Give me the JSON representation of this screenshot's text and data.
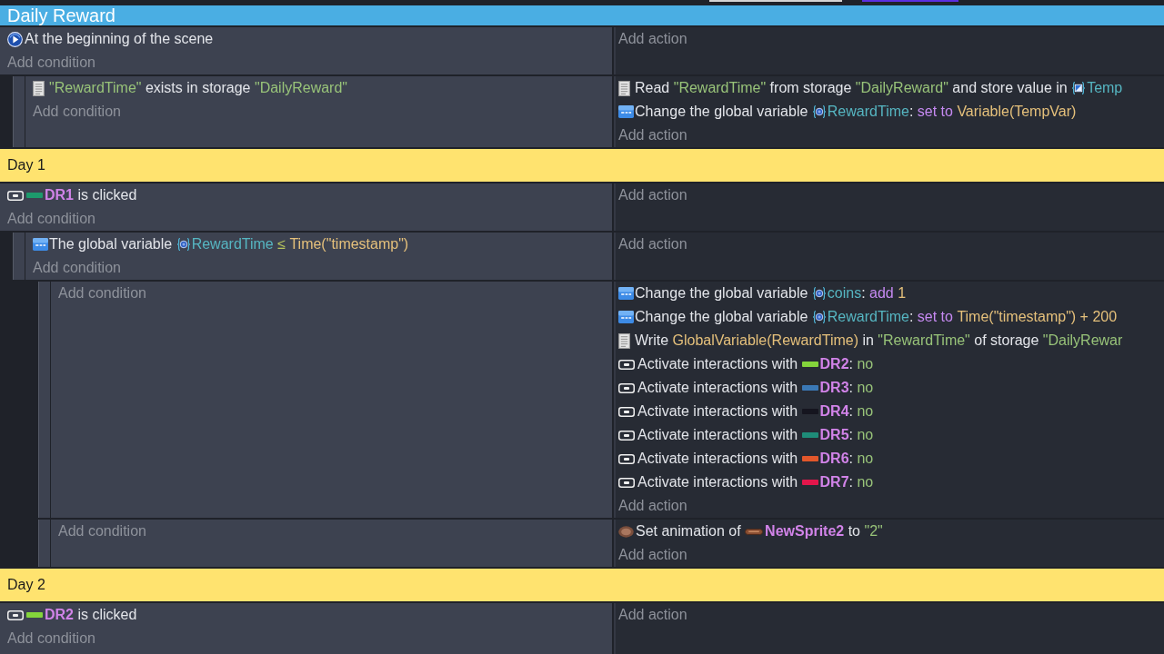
{
  "events": [
    {
      "kind": "group",
      "title": "Daily Reward"
    },
    {
      "kind": "event",
      "conditions": [
        {
          "kind": "scene_start",
          "parts": [
            {
              "kind": "plain",
              "text": "At the beginning of the scene"
            }
          ]
        }
      ],
      "add_condition": "Add condition",
      "add_action": "Add action",
      "children": [
        {
          "kind": "event",
          "conditions": [
            {
              "kind": "storage",
              "parts": [
                {
                  "kind": "string",
                  "text": "\"RewardTime\""
                },
                {
                  "kind": "plain",
                  "text": " exists in storage "
                },
                {
                  "kind": "string",
                  "text": "\"DailyReward\""
                }
              ]
            }
          ],
          "add_condition": "Add condition",
          "actions": [
            {
              "kind": "storage",
              "parts": [
                {
                  "kind": "plain",
                  "text": "Read "
                },
                {
                  "kind": "string",
                  "text": "\"RewardTime\""
                },
                {
                  "kind": "plain",
                  "text": " from storage "
                },
                {
                  "kind": "string",
                  "text": "\"DailyReward\""
                },
                {
                  "kind": "plain",
                  "text": " and store value in "
                },
                {
                  "kind": "scene_variable",
                  "text": "Temp"
                }
              ]
            },
            {
              "kind": "variable",
              "parts": [
                {
                  "kind": "plain",
                  "text": "Change the global variable "
                },
                {
                  "kind": "global_variable",
                  "text": "RewardTime"
                },
                {
                  "kind": "plain",
                  "text": ": "
                },
                {
                  "kind": "operator",
                  "text": "set to "
                },
                {
                  "kind": "expression",
                  "text": "Variable(TempVar)"
                }
              ]
            }
          ],
          "add_action": "Add action"
        }
      ]
    },
    {
      "kind": "comment",
      "text": "Day 1"
    },
    {
      "kind": "event",
      "conditions": [
        {
          "kind": "button",
          "parts": [
            {
              "kind": "object",
              "text": "DR1",
              "color": "#1d9a6c"
            },
            {
              "kind": "plain",
              "text": " is clicked"
            }
          ]
        }
      ],
      "add_condition": "Add condition",
      "add_action": "Add action",
      "children": [
        {
          "kind": "event",
          "conditions": [
            {
              "kind": "variable",
              "parts": [
                {
                  "kind": "plain",
                  "text": "The global variable "
                },
                {
                  "kind": "global_variable",
                  "text": "RewardTime"
                },
                {
                  "kind": "comparison",
                  "text": " ≤ "
                },
                {
                  "kind": "expression",
                  "text": "Time(\"timestamp\")"
                }
              ]
            }
          ],
          "add_condition": "Add condition",
          "add_action": "Add action",
          "children": [
            {
              "kind": "event",
              "add_condition": "Add condition",
              "actions": [
                {
                  "kind": "variable",
                  "parts": [
                    {
                      "kind": "plain",
                      "text": "Change the global variable "
                    },
                    {
                      "kind": "global_variable",
                      "text": "coins"
                    },
                    {
                      "kind": "plain",
                      "text": ": "
                    },
                    {
                      "kind": "operator",
                      "text": "add "
                    },
                    {
                      "kind": "expression",
                      "text": "1"
                    }
                  ]
                },
                {
                  "kind": "variable",
                  "parts": [
                    {
                      "kind": "plain",
                      "text": "Change the global variable "
                    },
                    {
                      "kind": "global_variable",
                      "text": "RewardTime"
                    },
                    {
                      "kind": "plain",
                      "text": ": "
                    },
                    {
                      "kind": "operator",
                      "text": "set to "
                    },
                    {
                      "kind": "expression",
                      "text": "Time(\"timestamp\") + 200"
                    }
                  ]
                },
                {
                  "kind": "storage",
                  "parts": [
                    {
                      "kind": "plain",
                      "text": "Write "
                    },
                    {
                      "kind": "expression",
                      "text": "GlobalVariable(RewardTime)"
                    },
                    {
                      "kind": "plain",
                      "text": " in "
                    },
                    {
                      "kind": "string",
                      "text": "\"RewardTime\""
                    },
                    {
                      "kind": "plain",
                      "text": " of storage "
                    },
                    {
                      "kind": "string",
                      "text": "\"DailyRewar"
                    }
                  ]
                },
                {
                  "kind": "button",
                  "parts": [
                    {
                      "kind": "plain",
                      "text": "Activate interactions with "
                    },
                    {
                      "kind": "object",
                      "text": "DR2",
                      "color": "#84d43b"
                    },
                    {
                      "kind": "plain",
                      "text": ": "
                    },
                    {
                      "kind": "string",
                      "text": "no"
                    }
                  ]
                },
                {
                  "kind": "button",
                  "parts": [
                    {
                      "kind": "plain",
                      "text": "Activate interactions with "
                    },
                    {
                      "kind": "object",
                      "text": "DR3",
                      "color": "#3a78b5"
                    },
                    {
                      "kind": "plain",
                      "text": ": "
                    },
                    {
                      "kind": "string",
                      "text": "no"
                    }
                  ]
                },
                {
                  "kind": "button",
                  "parts": [
                    {
                      "kind": "plain",
                      "text": "Activate interactions with "
                    },
                    {
                      "kind": "object",
                      "text": "DR4",
                      "color": "#15151f"
                    },
                    {
                      "kind": "plain",
                      "text": ": "
                    },
                    {
                      "kind": "string",
                      "text": "no"
                    }
                  ]
                },
                {
                  "kind": "button",
                  "parts": [
                    {
                      "kind": "plain",
                      "text": "Activate interactions with "
                    },
                    {
                      "kind": "object",
                      "text": "DR5",
                      "color": "#1e8c78"
                    },
                    {
                      "kind": "plain",
                      "text": ": "
                    },
                    {
                      "kind": "string",
                      "text": "no"
                    }
                  ]
                },
                {
                  "kind": "button",
                  "parts": [
                    {
                      "kind": "plain",
                      "text": "Activate interactions with "
                    },
                    {
                      "kind": "object",
                      "text": "DR6",
                      "color": "#e2572b"
                    },
                    {
                      "kind": "plain",
                      "text": ": "
                    },
                    {
                      "kind": "string",
                      "text": "no"
                    }
                  ]
                },
                {
                  "kind": "button",
                  "parts": [
                    {
                      "kind": "plain",
                      "text": "Activate interactions with "
                    },
                    {
                      "kind": "object",
                      "text": "DR7",
                      "color": "#e3164b"
                    },
                    {
                      "kind": "plain",
                      "text": ": "
                    },
                    {
                      "kind": "string",
                      "text": "no"
                    }
                  ]
                }
              ],
              "add_action": "Add action"
            },
            {
              "kind": "event",
              "add_condition": "Add condition",
              "actions": [
                {
                  "kind": "sprite",
                  "parts": [
                    {
                      "kind": "plain",
                      "text": "Set animation of "
                    },
                    {
                      "kind": "sprite_object",
                      "text": "NewSprite2"
                    },
                    {
                      "kind": "plain",
                      "text": " to "
                    },
                    {
                      "kind": "string",
                      "text": "\"2\""
                    }
                  ]
                }
              ],
              "add_action": "Add action"
            }
          ]
        }
      ]
    },
    {
      "kind": "comment",
      "text": "Day 2"
    },
    {
      "kind": "event",
      "conditions": [
        {
          "kind": "button",
          "parts": [
            {
              "kind": "object",
              "text": "DR2",
              "color": "#84d43b"
            },
            {
              "kind": "plain",
              "text": " is clicked"
            }
          ]
        }
      ],
      "add_condition": "Add condition",
      "add_action": "Add action"
    }
  ]
}
